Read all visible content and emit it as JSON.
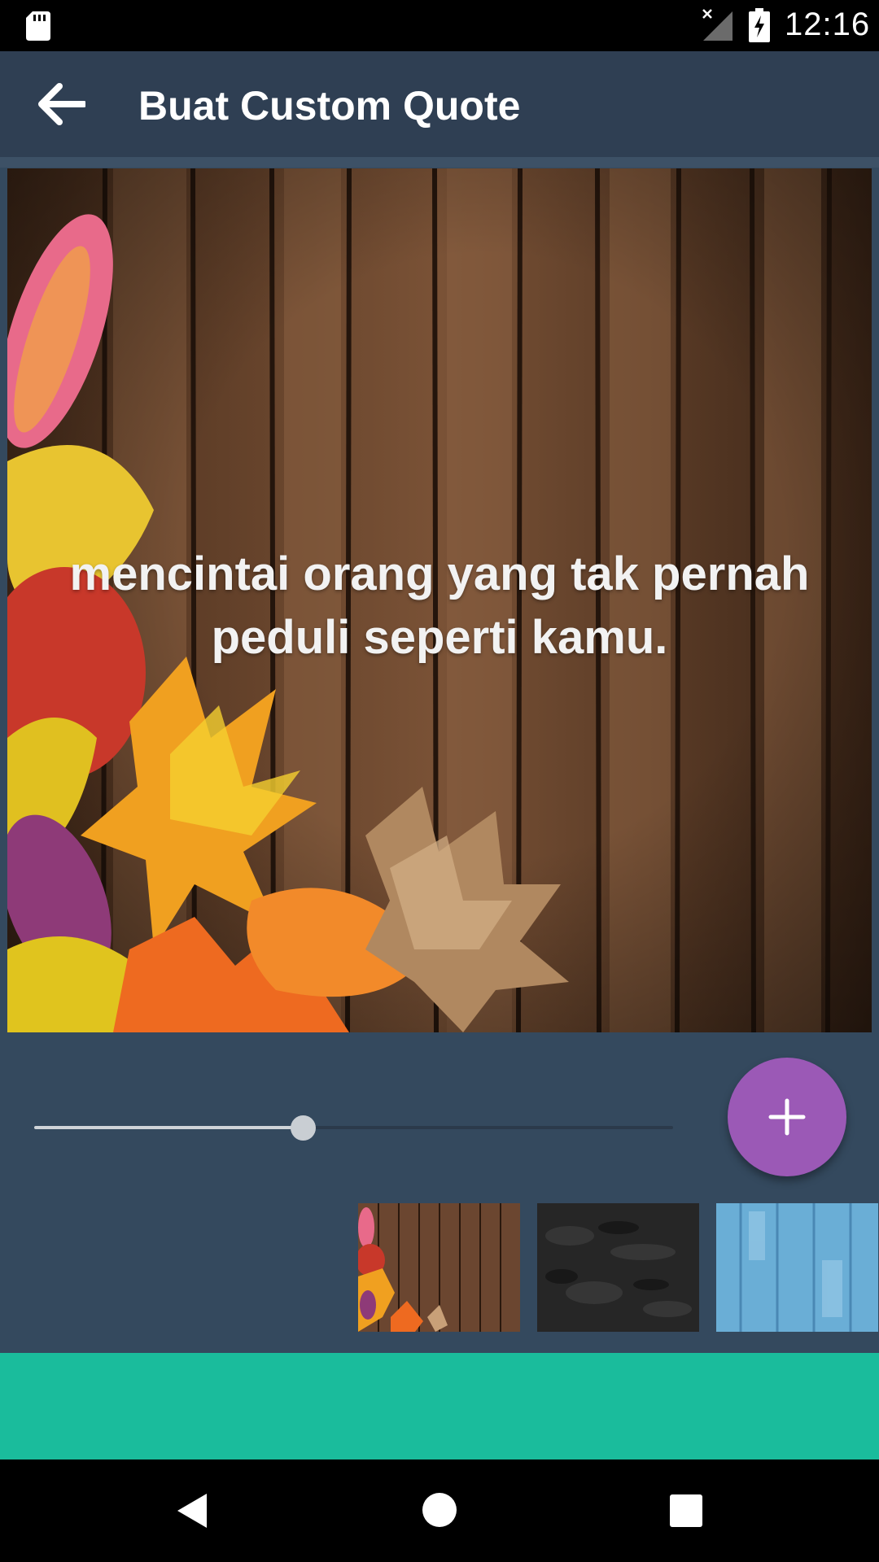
{
  "status_bar": {
    "time": "12:16",
    "icons": [
      "sd-card-icon",
      "no-signal-icon",
      "battery-charging-icon"
    ]
  },
  "app_bar": {
    "title": "Buat Custom Quote",
    "back_icon": "arrow-back-icon"
  },
  "canvas": {
    "quote_text": "mencintai orang yang tak pernah peduli seperti kamu.",
    "background": "autumn-leaves-on-wood"
  },
  "text_size_slider": {
    "value_fraction": 0.42
  },
  "add_button": {
    "icon": "plus-icon",
    "color": "#9b59b6"
  },
  "background_options": [
    {
      "name": "autumn-leaves-wood"
    },
    {
      "name": "dark-slate"
    },
    {
      "name": "blue-wood"
    }
  ],
  "colors": {
    "app_bg": "#34495e",
    "app_bar": "#2f3f53",
    "ad_banner": "#1abc9c"
  },
  "nav_bar": {
    "icons": [
      "nav-back-icon",
      "nav-home-icon",
      "nav-recents-icon"
    ]
  }
}
